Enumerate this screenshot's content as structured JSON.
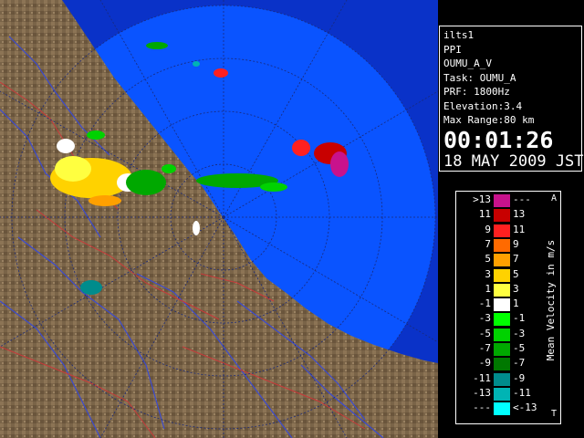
{
  "info": {
    "radar_name": "ilts1",
    "scan_type": "PPI",
    "product": "OUMU_A_V",
    "task": "Task: OUMU_A",
    "prf": "PRF: 1800Hz",
    "elevation": "Elevation:3.4",
    "max_range": "Max Range:80 km",
    "time": "00:01:26",
    "date": "18 MAY 2009 JST"
  },
  "legend": {
    "title": "Mean Velocity in m/s",
    "corner_top": "A",
    "corner_bottom": "T",
    "rows": [
      {
        "lo": ">13",
        "hi": "---",
        "color": "#c8128c"
      },
      {
        "lo": "11",
        "hi": "13",
        "color": "#c80000"
      },
      {
        "lo": "9",
        "hi": "11",
        "color": "#ff2020"
      },
      {
        "lo": "7",
        "hi": "9",
        "color": "#ff6a00"
      },
      {
        "lo": "5",
        "hi": "7",
        "color": "#ffa000"
      },
      {
        "lo": "3",
        "hi": "5",
        "color": "#ffd200"
      },
      {
        "lo": "1",
        "hi": "3",
        "color": "#ffff40"
      },
      {
        "lo": "-1",
        "hi": "1",
        "color": "#ffffff"
      },
      {
        "lo": "-3",
        "hi": "-1",
        "color": "#00ff00"
      },
      {
        "lo": "-5",
        "hi": "-3",
        "color": "#00d200"
      },
      {
        "lo": "-7",
        "hi": "-5",
        "color": "#00a800"
      },
      {
        "lo": "-9",
        "hi": "-7",
        "color": "#007800"
      },
      {
        "lo": "-11",
        "hi": "-9",
        "color": "#008c8c"
      },
      {
        "lo": "-13",
        "hi": "-11",
        "color": "#00b4b4"
      },
      {
        "lo": "---",
        "hi": "<-13",
        "color": "#00ffff"
      }
    ]
  },
  "map": {
    "sea_color": "#0a54ff",
    "outer_band_color": "#0a32c8",
    "land_color": "#7a6448",
    "river_color": "#3a4ad0",
    "border_color": "#c83a3a"
  }
}
